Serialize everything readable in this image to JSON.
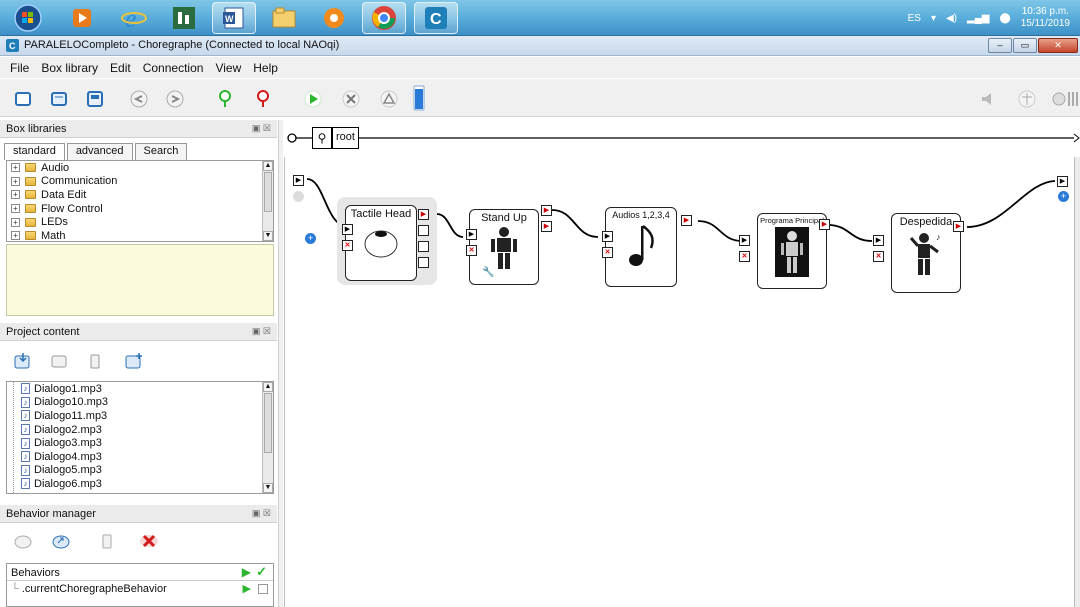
{
  "taskbar": {
    "lang": "ES",
    "time": "10:36 p.m.",
    "date": "15/11/2019",
    "apps": [
      "start-orb",
      "media-player",
      "internet-explorer",
      "bar-app",
      "word",
      "file-explorer",
      "settings-app",
      "chrome",
      "choregraphe"
    ]
  },
  "window": {
    "title": "PARALELOCompleto - Choregraphe (Connected to local NAOqi)"
  },
  "menu": [
    "File",
    "Box library",
    "Edit",
    "Connection",
    "View",
    "Help"
  ],
  "breadcrumb": {
    "root_label": "root"
  },
  "box_libraries": {
    "title": "Box libraries",
    "tabs": [
      "standard",
      "advanced",
      "Search"
    ],
    "selected_tab": "standard",
    "items": [
      "Audio",
      "Communication",
      "Data Edit",
      "Flow Control",
      "LEDs",
      "Math"
    ]
  },
  "project_content": {
    "title": "Project content",
    "files": [
      "Dialogo1.mp3",
      "Dialogo10.mp3",
      "Dialogo11.mp3",
      "Dialogo2.mp3",
      "Dialogo3.mp3",
      "Dialogo4.mp3",
      "Dialogo5.mp3",
      "Dialogo6.mp3"
    ]
  },
  "behavior_manager": {
    "title": "Behavior manager",
    "column": "Behaviors",
    "items": [
      ".currentChoregrapheBehavior"
    ]
  },
  "flow": {
    "boxes": [
      {
        "name": "tactile-head",
        "label": "Tactile Head"
      },
      {
        "name": "stand-up",
        "label": "Stand Up"
      },
      {
        "name": "audios",
        "label": "Audios 1,2,3,4"
      },
      {
        "name": "programa",
        "label": "Programa Principal"
      },
      {
        "name": "despedida",
        "label": "Despedida"
      }
    ]
  },
  "colors": {
    "accent": "#2a7bd8",
    "play": "#2db52d",
    "stop": "#d21a1a",
    "selection": "#e6e6e6"
  }
}
